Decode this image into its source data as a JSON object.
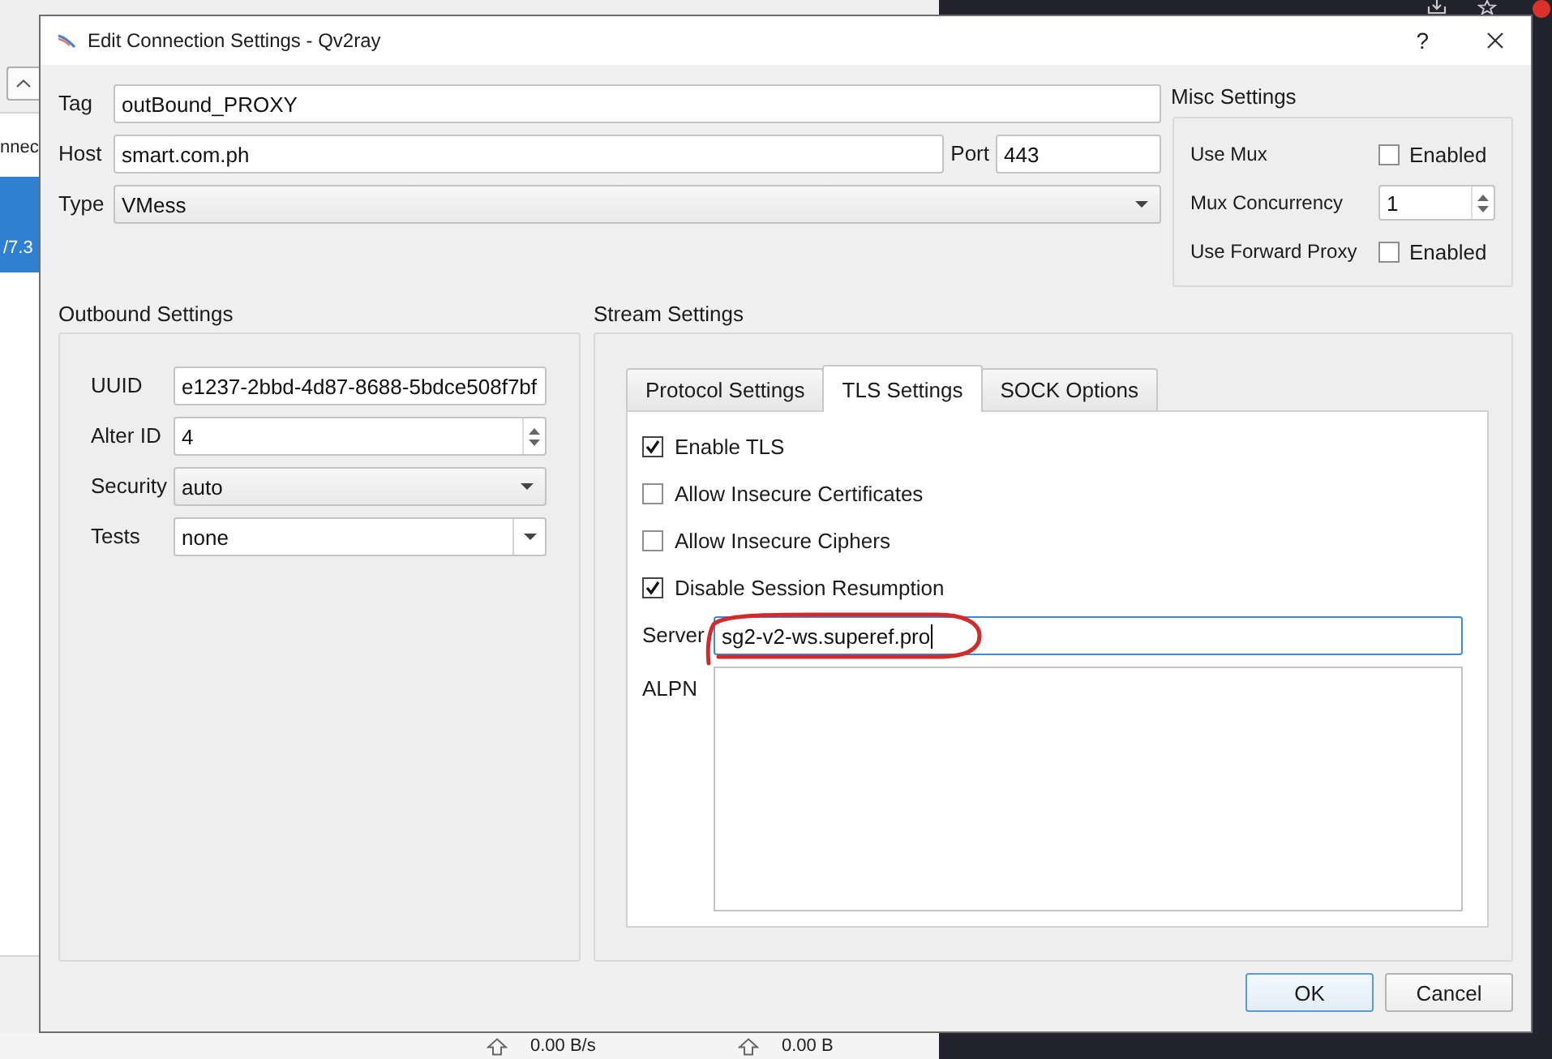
{
  "background": {
    "left_header": "nnec",
    "list": [
      {
        "text": "/7.3",
        "selected": true
      }
    ],
    "status": [
      {
        "value": "0.00 B/s"
      },
      {
        "value": "0.00 B"
      }
    ]
  },
  "dialog": {
    "title": "Edit Connection Settings - Qv2ray",
    "help": "?"
  },
  "general": {
    "tag": {
      "label": "Tag",
      "value": "outBound_PROXY"
    },
    "host": {
      "label": "Host",
      "value": "smart.com.ph"
    },
    "port": {
      "label": "Port",
      "value": "443"
    },
    "type": {
      "label": "Type",
      "value": "VMess"
    }
  },
  "misc_settings": {
    "title": "Misc Settings",
    "rows": [
      {
        "kind": "checkbox",
        "label": "Use Mux",
        "text": "Enabled",
        "checked": false
      },
      {
        "kind": "spinbox",
        "label": "Mux Concurrency",
        "value": "1"
      },
      {
        "kind": "checkbox",
        "label": "Use Forward Proxy",
        "text": "Enabled",
        "checked": false
      }
    ]
  },
  "outbound_settings": {
    "title": "Outbound Settings",
    "rows": [
      {
        "kind": "text",
        "label": "UUID",
        "value": "e1237-2bbd-4d87-8688-5bdce508f7bf"
      },
      {
        "kind": "spinbox",
        "label": "Alter ID",
        "value": "4"
      },
      {
        "kind": "dropdown",
        "label": "Security",
        "value": "auto"
      },
      {
        "kind": "editable_dropdown",
        "label": "Tests",
        "value": "none"
      }
    ]
  },
  "stream_settings": {
    "title": "Stream Settings",
    "tabs": [
      {
        "label": "Protocol Settings",
        "selected": false
      },
      {
        "label": "TLS Settings",
        "selected": true
      },
      {
        "label": "SOCK Options",
        "selected": false
      }
    ],
    "options": [
      {
        "label": "Enable TLS",
        "checked": true
      },
      {
        "label": "Allow Insecure Certificates",
        "checked": false
      },
      {
        "label": "Allow Insecure Ciphers",
        "checked": false
      },
      {
        "label": "Disable Session Resumption",
        "checked": true
      }
    ],
    "server": {
      "label": "Server",
      "value": "sg2-v2-ws.superef.pro",
      "focused": true,
      "circled": true
    },
    "alpn": {
      "label": "ALPN"
    }
  },
  "buttons": [
    {
      "label": "OK",
      "default": true
    },
    {
      "label": "Cancel",
      "default": false
    }
  ]
}
